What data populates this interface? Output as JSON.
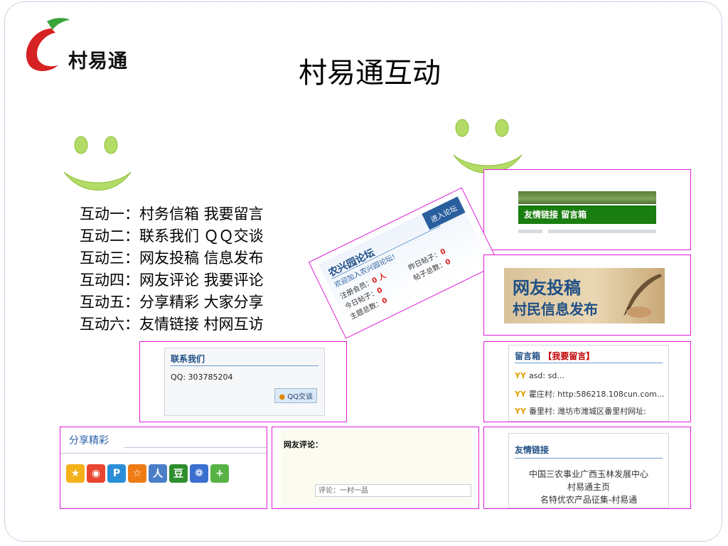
{
  "logo": {
    "text": "村易通"
  },
  "page": {
    "title": "村易通互动"
  },
  "interactions": [
    "互动一：村务信箱  我要留言",
    "互动二：联系我们  ＱＱ交谈",
    "互动三：网友投稿  信息发布",
    "互动四：网友评论  我要评论",
    "互动五：分享精彩  大家分享",
    "互动六：友情链接  村网互访"
  ],
  "friend_bar": {
    "label": "友情链接  留言箱"
  },
  "forum": {
    "title": "农兴园论坛",
    "enter": "进入论坛",
    "welcome": "欢迎加入农兴园论坛!",
    "members_label": "注册会员：",
    "members_value": "0 人",
    "today_label": "今日帖子：",
    "today_value": "0",
    "yesterday_label": "昨日帖子：",
    "yesterday_value": "0",
    "topics_label": "主题总数：",
    "topics_value": "0",
    "posts_label": "帖子总数：",
    "posts_value": "0"
  },
  "contribute": {
    "line1": "网友投稿",
    "line2": "村民信息发布"
  },
  "contact": {
    "title": "联系我们",
    "qq": "QQ: 303785204",
    "button": "QQ交谈"
  },
  "guestbook": {
    "title": "留言箱",
    "action": "【我要留言】",
    "items": [
      "asd: sd...",
      "霍庄村: http:586218.108cun.com...",
      "番里村: 潍坊市潍城区番里村网址:"
    ]
  },
  "share": {
    "title": "分享精彩",
    "icons": [
      "qzone-icon",
      "weibo-icon",
      "pengyou-icon",
      "qqstar-icon",
      "renren-icon",
      "douban-icon",
      "baidu-icon",
      "more-icon"
    ],
    "douban_char": "豆",
    "more_char": "+"
  },
  "comment": {
    "title": "网友评论：",
    "placeholder": "评论：一村一品"
  },
  "links": {
    "title": "友情链接",
    "items": [
      "中国三农事业广西玉林发展中心",
      "村易通主页",
      "名特优农产品征集-村易通"
    ]
  },
  "colors": {
    "magenta_border": "#e01bd9",
    "green": "#1a7d10",
    "smile": "#a8d84a",
    "navy": "#1f4f86"
  }
}
